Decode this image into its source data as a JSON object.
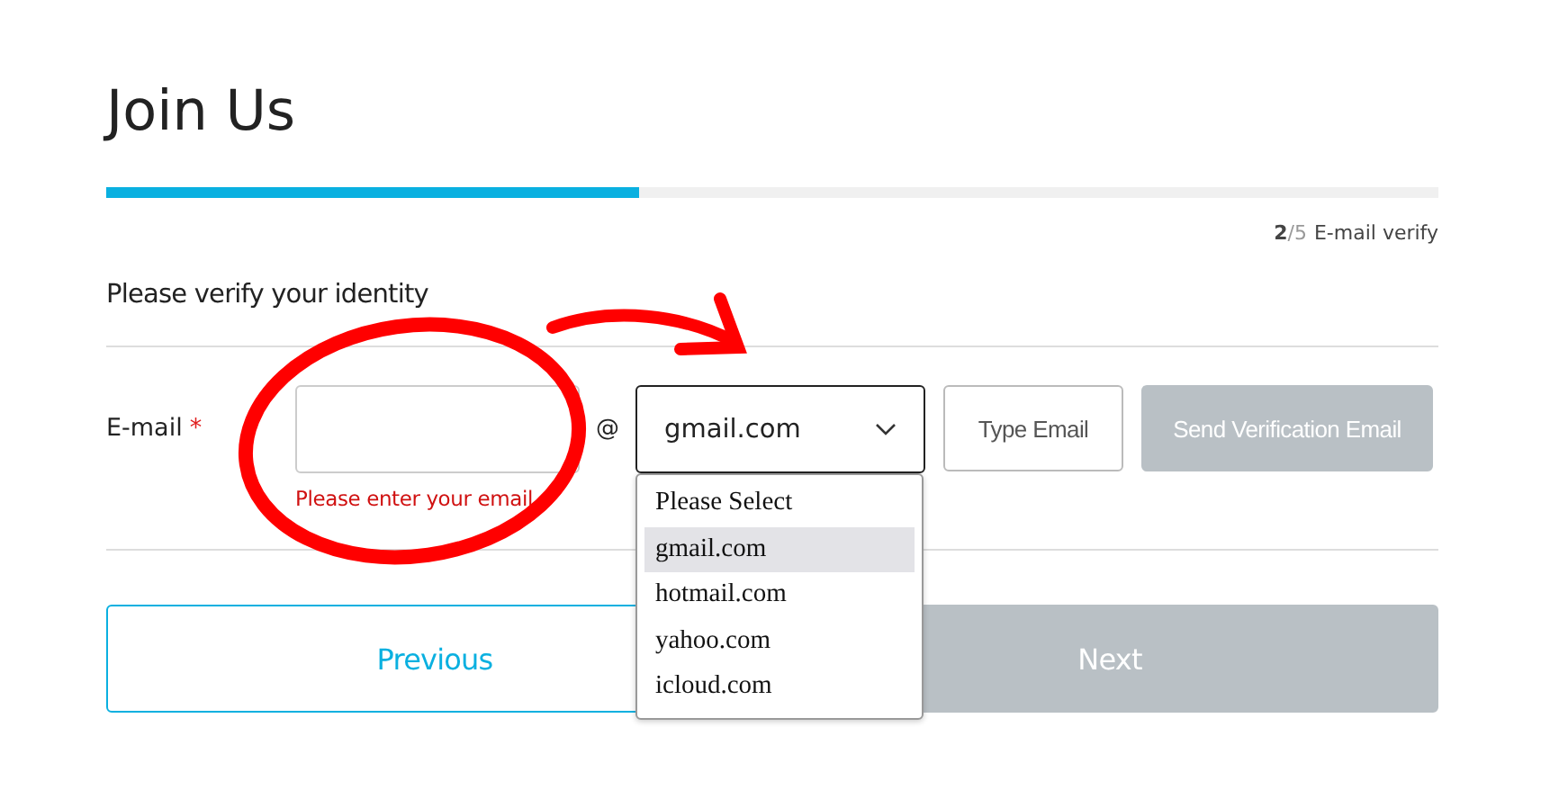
{
  "title": "Join Us",
  "progress": {
    "level": 0.4,
    "step": "2",
    "total": "/5",
    "label": "E-mail verify"
  },
  "section_title": "Please verify your identity",
  "email": {
    "label": "E-mail",
    "required_mark": "*",
    "error": "Please enter your email",
    "at": "@",
    "domain": "gmail.com",
    "dropdown_open": true,
    "options": [
      {
        "label": "Please Select",
        "selected": false
      },
      {
        "label": "gmail.com",
        "selected": true
      },
      {
        "label": "hotmail.com",
        "selected": false
      },
      {
        "label": "yahoo.com",
        "selected": false
      },
      {
        "label": "icloud.com",
        "selected": false
      }
    ]
  },
  "row_buttons": [
    {
      "label": "Type Email",
      "disabled": false
    },
    {
      "label": "Send Verification Email",
      "disabled": true
    }
  ],
  "nav_buttons": [
    {
      "label": "Previous",
      "disabled": false
    },
    {
      "label": "Next",
      "disabled": true
    }
  ]
}
